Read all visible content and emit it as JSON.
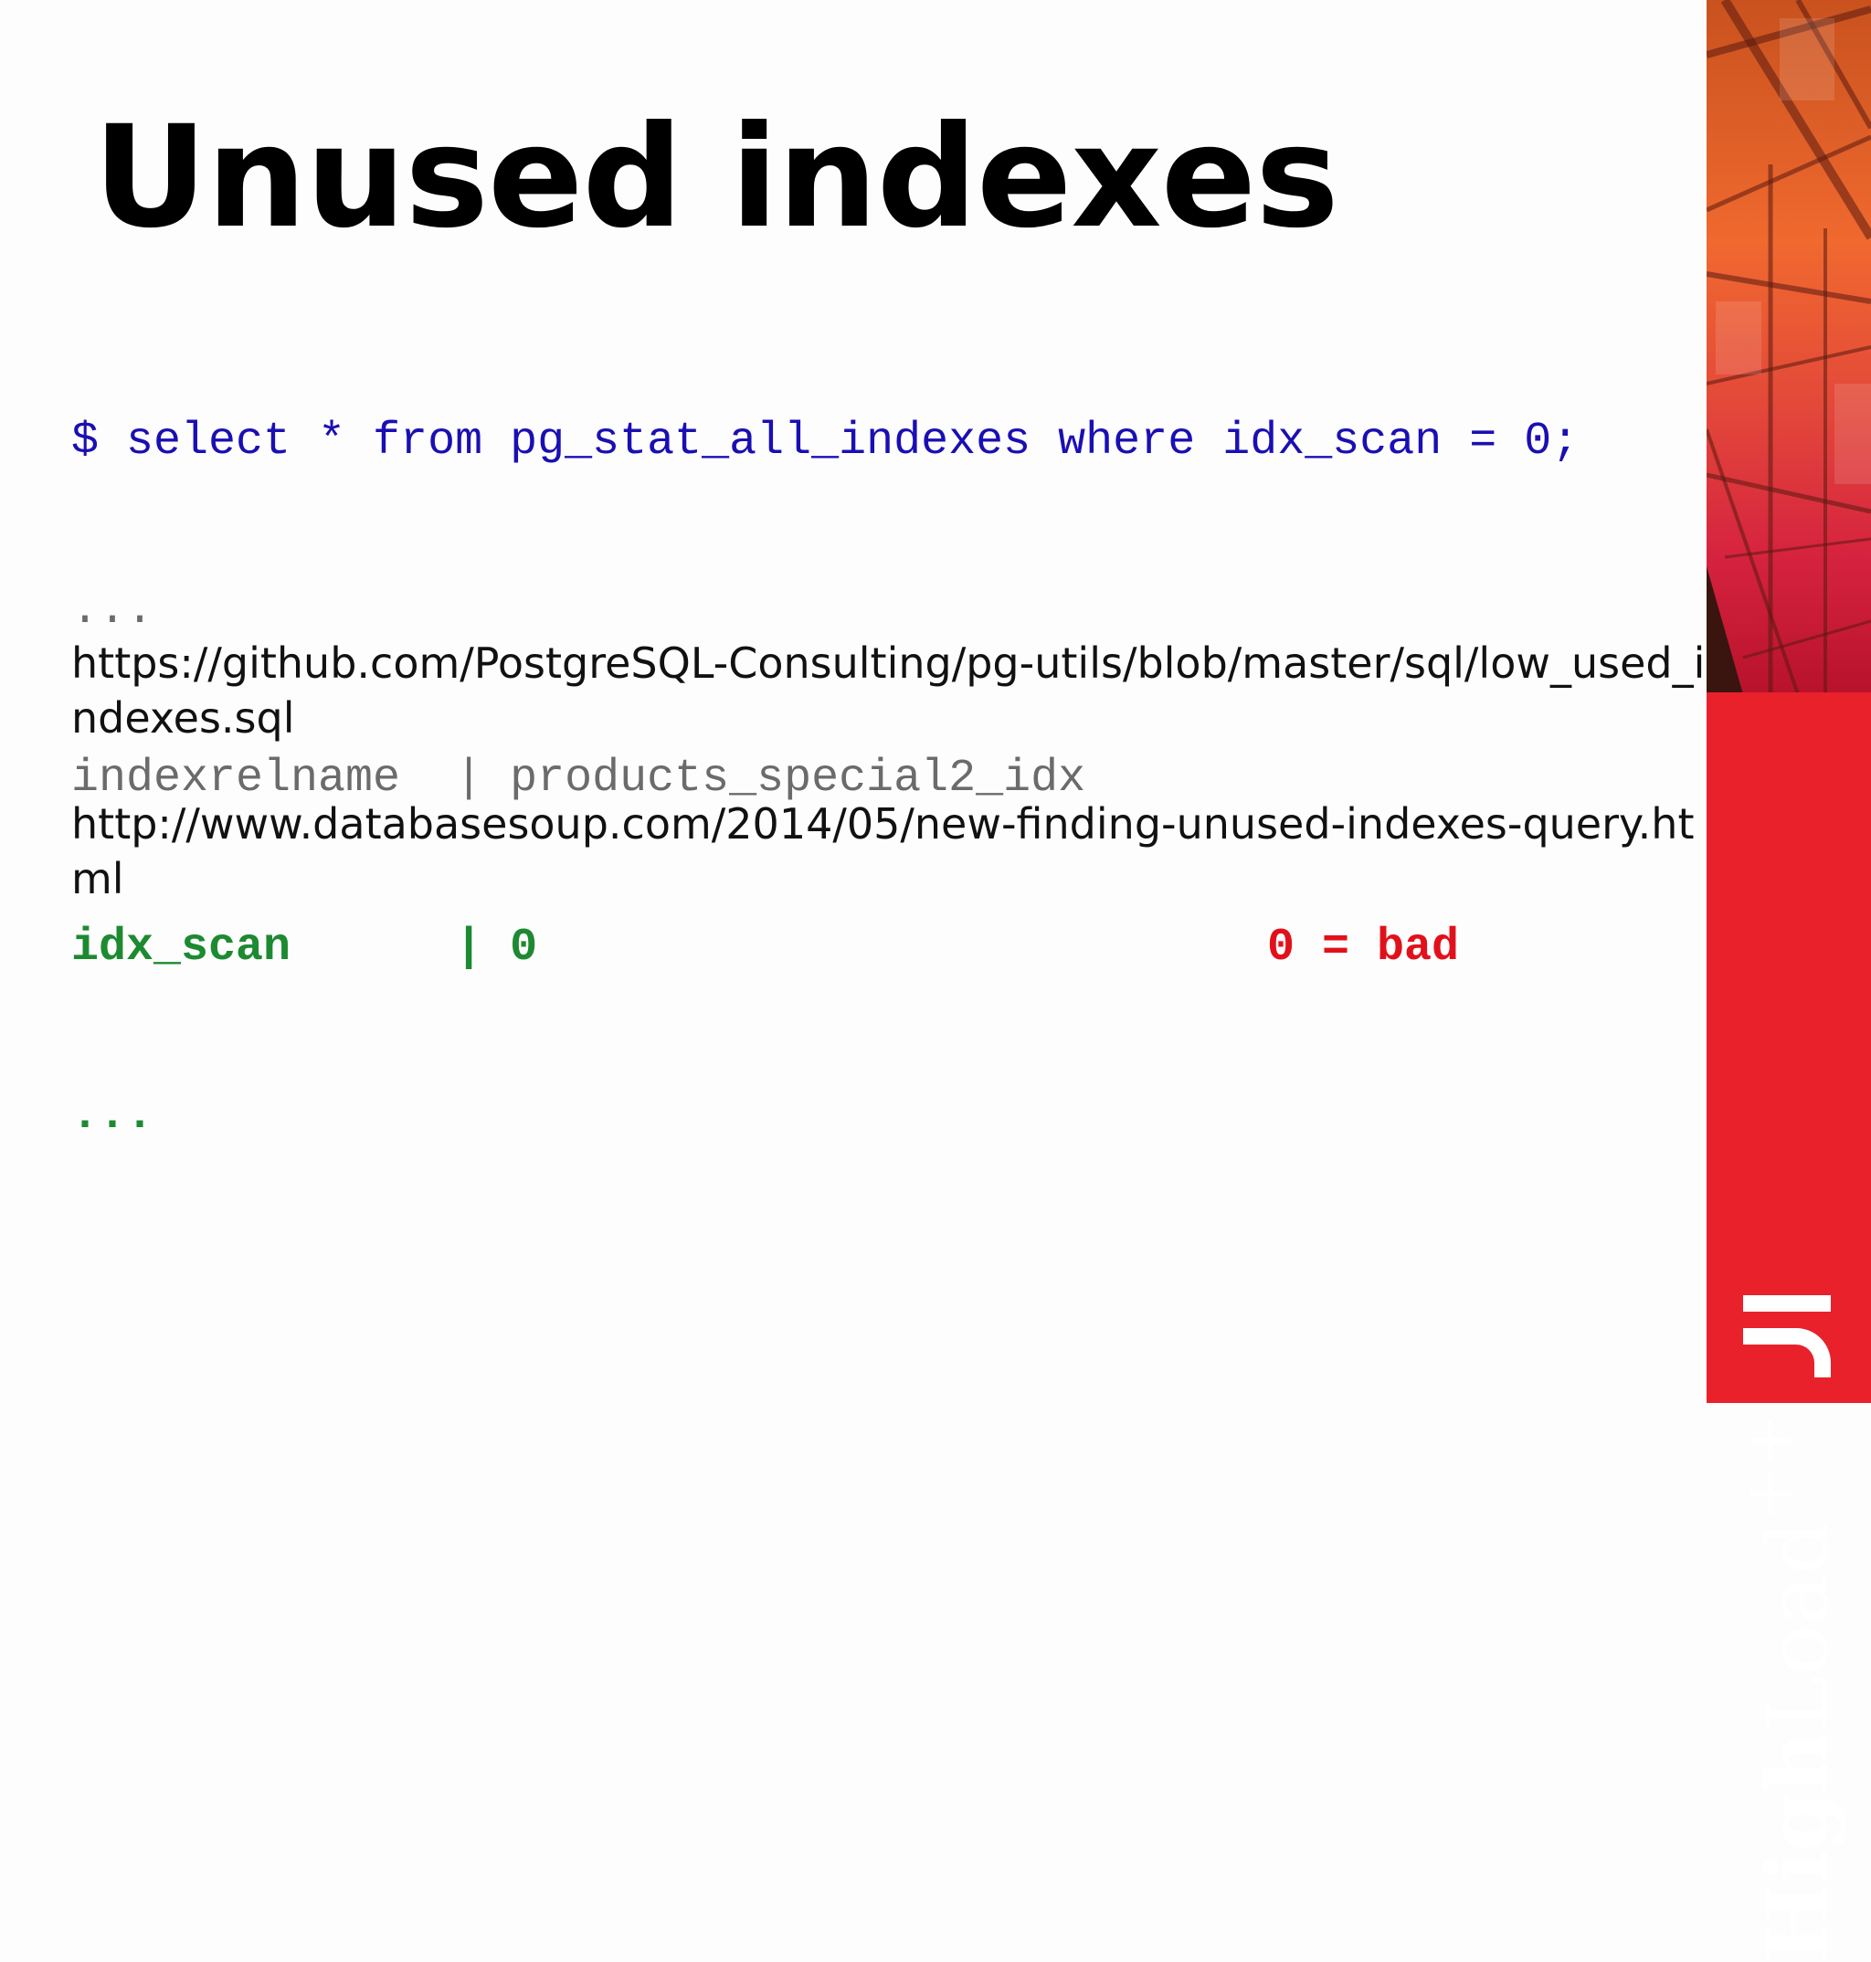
{
  "title": "Unused indexes",
  "code": {
    "query": "$ select * from pg_stat_all_indexes where idx_scan = 0;",
    "ellipsis_top": "...",
    "row1_label": "indexrelname  | ",
    "row1_value": "products_special2_idx",
    "row2_label": "idx_scan      | ",
    "row2_value": "0",
    "row2_note": "0 = bad",
    "ellipsis_bottom": "..."
  },
  "links": [
    "https://github.com/PostgreSQL-Consulting/pg-utils/blob/master/sql/low_used_indexes.sql",
    "http://www.databasesoup.com/2014/05/new-finding-unused-indexes-query.html"
  ],
  "brand": {
    "bold": "High",
    "light": "Load",
    "sup": "++"
  },
  "colors": {
    "query": "#1a0fb3",
    "gray": "#6b6b6b",
    "green": "#1d8a31",
    "red": "#e1111b",
    "brand_red": "#e8212b"
  },
  "icons": [
    "brand-logo-mark-icon"
  ]
}
